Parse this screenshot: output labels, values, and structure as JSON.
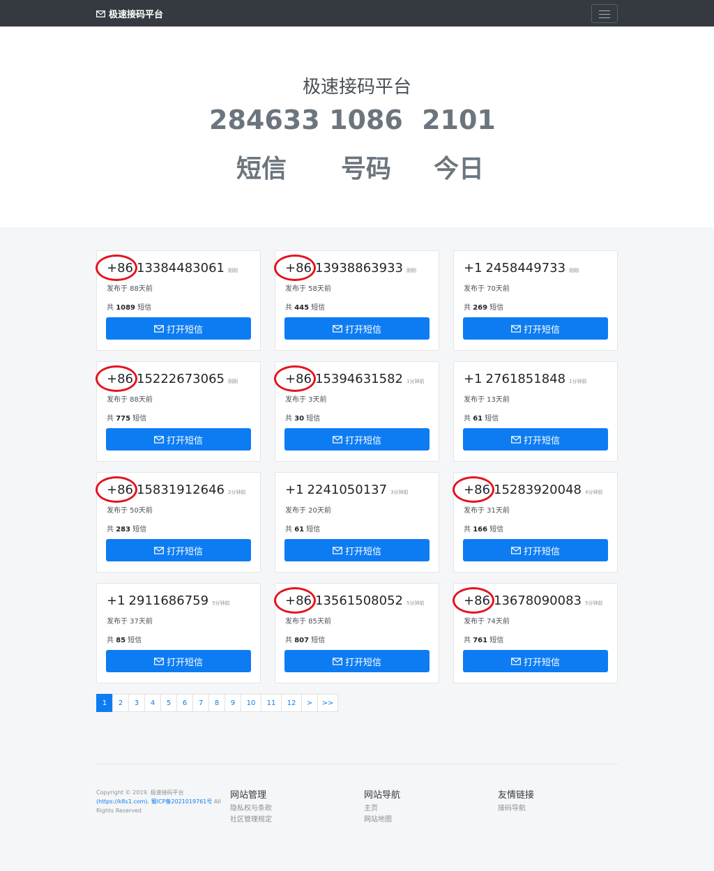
{
  "navbar": {
    "brand": "极速接码平台"
  },
  "hero": {
    "title": "极速接码平台",
    "stats": [
      {
        "value": "284633",
        "label": "短信"
      },
      {
        "value": "1086",
        "label": "号码"
      },
      {
        "value": "2101",
        "label": "今日"
      }
    ]
  },
  "cards": [
    {
      "country_code": "+86",
      "number": "13384483061",
      "ago": "刚刚",
      "posted": "发布于 88天前",
      "total_prefix": "共",
      "count": "1089",
      "total_suffix": "短信",
      "button": "打开短信",
      "highlighted": true
    },
    {
      "country_code": "+86",
      "number": "13938863933",
      "ago": "刚刚",
      "posted": "发布于 58天前",
      "total_prefix": "共",
      "count": "445",
      "total_suffix": "短信",
      "button": "打开短信",
      "highlighted": true
    },
    {
      "country_code": "+1",
      "number": "2458449733",
      "ago": "刚刚",
      "posted": "发布于 70天前",
      "total_prefix": "共",
      "count": "269",
      "total_suffix": "短信",
      "button": "打开短信",
      "highlighted": false
    },
    {
      "country_code": "+86",
      "number": "15222673065",
      "ago": "刚刚",
      "posted": "发布于 88天前",
      "total_prefix": "共",
      "count": "775",
      "total_suffix": "短信",
      "button": "打开短信",
      "highlighted": true
    },
    {
      "country_code": "+86",
      "number": "15394631582",
      "ago": "1分钟前",
      "posted": "发布于 3天前",
      "total_prefix": "共",
      "count": "30",
      "total_suffix": "短信",
      "button": "打开短信",
      "highlighted": true
    },
    {
      "country_code": "+1",
      "number": "2761851848",
      "ago": "1分钟前",
      "posted": "发布于 13天前",
      "total_prefix": "共",
      "count": "61",
      "total_suffix": "短信",
      "button": "打开短信",
      "highlighted": false
    },
    {
      "country_code": "+86",
      "number": "15831912646",
      "ago": "2分钟前",
      "posted": "发布于 50天前",
      "total_prefix": "共",
      "count": "283",
      "total_suffix": "短信",
      "button": "打开短信",
      "highlighted": true
    },
    {
      "country_code": "+1",
      "number": "2241050137",
      "ago": "3分钟前",
      "posted": "发布于 20天前",
      "total_prefix": "共",
      "count": "61",
      "total_suffix": "短信",
      "button": "打开短信",
      "highlighted": false
    },
    {
      "country_code": "+86",
      "number": "15283920048",
      "ago": "4分钟前",
      "posted": "发布于 31天前",
      "total_prefix": "共",
      "count": "166",
      "total_suffix": "短信",
      "button": "打开短信",
      "highlighted": true
    },
    {
      "country_code": "+1",
      "number": "2911686759",
      "ago": "5分钟前",
      "posted": "发布于 37天前",
      "total_prefix": "共",
      "count": "85",
      "total_suffix": "短信",
      "button": "打开短信",
      "highlighted": false
    },
    {
      "country_code": "+86",
      "number": "13561508052",
      "ago": "5分钟前",
      "posted": "发布于 85天前",
      "total_prefix": "共",
      "count": "807",
      "total_suffix": "短信",
      "button": "打开短信",
      "highlighted": true
    },
    {
      "country_code": "+86",
      "number": "13678090083",
      "ago": "5分钟前",
      "posted": "发布于 74天前",
      "total_prefix": "共",
      "count": "761",
      "total_suffix": "短信",
      "button": "打开短信",
      "highlighted": true
    }
  ],
  "pagination": [
    "1",
    "2",
    "3",
    "4",
    "5",
    "6",
    "7",
    "8",
    "9",
    "10",
    "11",
    "12",
    ">",
    ">>"
  ],
  "pagination_active": "1",
  "footer": {
    "copyright_line1": "Copyright © 2019. 极速接码平台",
    "copyright_url": "(https://k8s1.com).",
    "copyright_icp": "蜀ICP备2021019761号",
    "copyright_tail": " All Rights Reserved",
    "columns": [
      {
        "heading": "网站管理",
        "links": [
          "隐私权与条款",
          "社区管理规定"
        ]
      },
      {
        "heading": "网站导航",
        "links": [
          "主页",
          "网站地图"
        ]
      },
      {
        "heading": "友情链接",
        "links": [
          "接码导航"
        ]
      }
    ]
  },
  "colors": {
    "primary": "#0d7cf2",
    "navbar": "#343a40",
    "highlight_circle": "#e3131e"
  }
}
